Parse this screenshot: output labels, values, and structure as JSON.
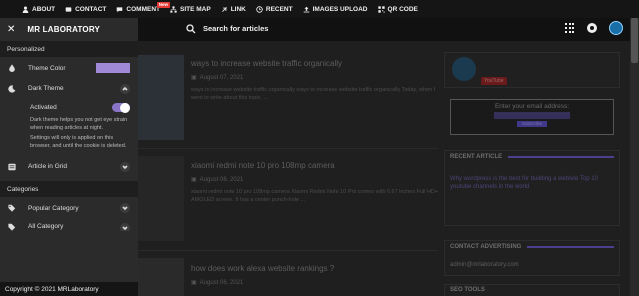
{
  "topbar": {
    "links": [
      {
        "label": "ABOUT",
        "icon": "user-icon"
      },
      {
        "label": "CONTACT",
        "icon": "contact-icon"
      },
      {
        "label": "COMMENT",
        "icon": "comment-icon",
        "badge": "New"
      },
      {
        "label": "SITE MAP",
        "icon": "sitemap-icon"
      },
      {
        "label": "LINK",
        "icon": "link-icon"
      },
      {
        "label": "RECENT",
        "icon": "recent-icon"
      },
      {
        "label": "IMAGES UPLOAD",
        "icon": "upload-icon"
      },
      {
        "label": "QR CODE",
        "icon": "qr-icon"
      }
    ]
  },
  "header": {
    "search_text": "Search for articles"
  },
  "sidebar": {
    "title": "MR LABORATORY",
    "personalized_label": "Personalized",
    "theme_color_label": "Theme Color",
    "theme_color": "#a08ad8",
    "dark_theme_label": "Dark Theme",
    "activated_label": "Activated",
    "dark_theme_desc": "Dark theme helps you not get eye strain when reading articles at night.",
    "dark_theme_note": "Settings will only is applied on this browser, and until the cookie is deleted.",
    "article_grid_label": "Article in Grid",
    "categories_label": "Categories",
    "popular_category_label": "Popular Category",
    "all_category_label": "All Category",
    "footer": "Copyright © 2021 MRLaboratory"
  },
  "posts": [
    {
      "title": "ways to increase website traffic organically",
      "date": "August 07, 2021",
      "snippet": "ways to increase website traffic organically  ways to increase website traffic organically  Today, when I went to write about this topic, ..."
    },
    {
      "title": "xiaomi redmi note 10 pro 108mp camera",
      "date": "August 06, 2021",
      "snippet": "xiaomi redmi note 10 pro 108mp camera Xiaomi Redmi Note 10 Pro comes with 6.67 inches Full HD+ AMOLED screen. It has a center punch-hole ..."
    },
    {
      "title": "how does work alexa website rankings ?",
      "date": "August 06, 2021",
      "snippet": ""
    }
  ],
  "widgets": {
    "youtube_badge": "YouTube",
    "email_label": "Enter your email address:",
    "subscribe_label": "Subscribe",
    "recent_article_heading": "RECENT ARTICLE",
    "recent_article_text": "Why wordpress is the best for building a website Top 10 youtube channels in the world",
    "contact_heading": "CONTACT ADVERTISING",
    "contact_email": "admin@mrlaboratory.com",
    "seo_heading": "SEO TOOLS"
  },
  "colors": {
    "accent": "#8a74c8",
    "background": "#1f1f1f",
    "sidebar_bg": "#2b2b2b"
  }
}
